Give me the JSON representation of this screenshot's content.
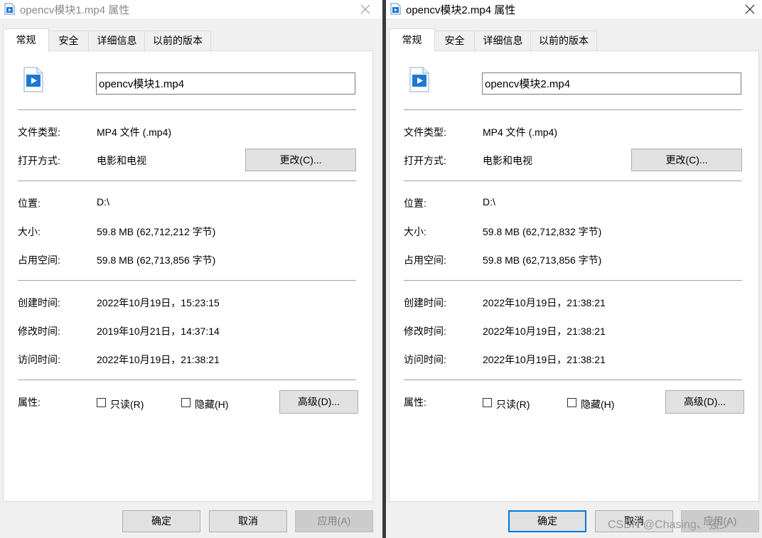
{
  "dialogs": [
    {
      "title": "opencv模块1.mp4 属性",
      "tabs": [
        "常规",
        "安全",
        "详细信息",
        "以前的版本"
      ],
      "filename": "opencv模块1.mp4",
      "rows": {
        "type_label": "文件类型:",
        "type_value": "MP4 文件 (.mp4)",
        "open_label": "打开方式:",
        "open_value": "电影和电视",
        "change_button": "更改(C)...",
        "location_label": "位置:",
        "location_value": "D:\\",
        "size_label": "大小:",
        "size_value": "59.8 MB (62,712,212 字节)",
        "disk_label": "占用空间:",
        "disk_value": "59.8 MB (62,713,856 字节)",
        "created_label": "创建时间:",
        "created_value": "2022年10月19日，15:23:15",
        "modified_label": "修改时间:",
        "modified_value": "2019年10月21日，14:37:14",
        "accessed_label": "访问时间:",
        "accessed_value": "2022年10月19日，21:38:21",
        "attributes_label": "属性:",
        "readonly_label": "只读(R)",
        "hidden_label": "隐藏(H)",
        "advanced_button": "高级(D)..."
      },
      "footer": {
        "ok": "确定",
        "cancel": "取消",
        "apply": "应用(A)"
      }
    },
    {
      "title": "opencv模块2.mp4 属性",
      "tabs": [
        "常规",
        "安全",
        "详细信息",
        "以前的版本"
      ],
      "filename": "opencv模块2.mp4",
      "rows": {
        "type_label": "文件类型:",
        "type_value": "MP4 文件 (.mp4)",
        "open_label": "打开方式:",
        "open_value": "电影和电视",
        "change_button": "更改(C)...",
        "location_label": "位置:",
        "location_value": "D:\\",
        "size_label": "大小:",
        "size_value": "59.8 MB (62,712,832 字节)",
        "disk_label": "占用空间:",
        "disk_value": "59.8 MB (62,713,856 字节)",
        "created_label": "创建时间:",
        "created_value": "2022年10月19日，21:38:21",
        "modified_label": "修改时间:",
        "modified_value": "2022年10月19日，21:38:21",
        "accessed_label": "访问时间:",
        "accessed_value": "2022年10月19日，21:38:21",
        "attributes_label": "属性:",
        "readonly_label": "只读(R)",
        "hidden_label": "隐藏(H)",
        "advanced_button": "高级(D)..."
      },
      "footer": {
        "ok": "确定",
        "cancel": "取消",
        "apply": "应用(A)"
      }
    }
  ],
  "watermark": "CSDN @Chasing、强少",
  "icons": {
    "file": "video-file-icon",
    "close": "close-icon"
  },
  "colors": {
    "accent": "#0078d7",
    "icon_blue": "#1e78d2",
    "dialog_bg": "#f0f0f0"
  }
}
